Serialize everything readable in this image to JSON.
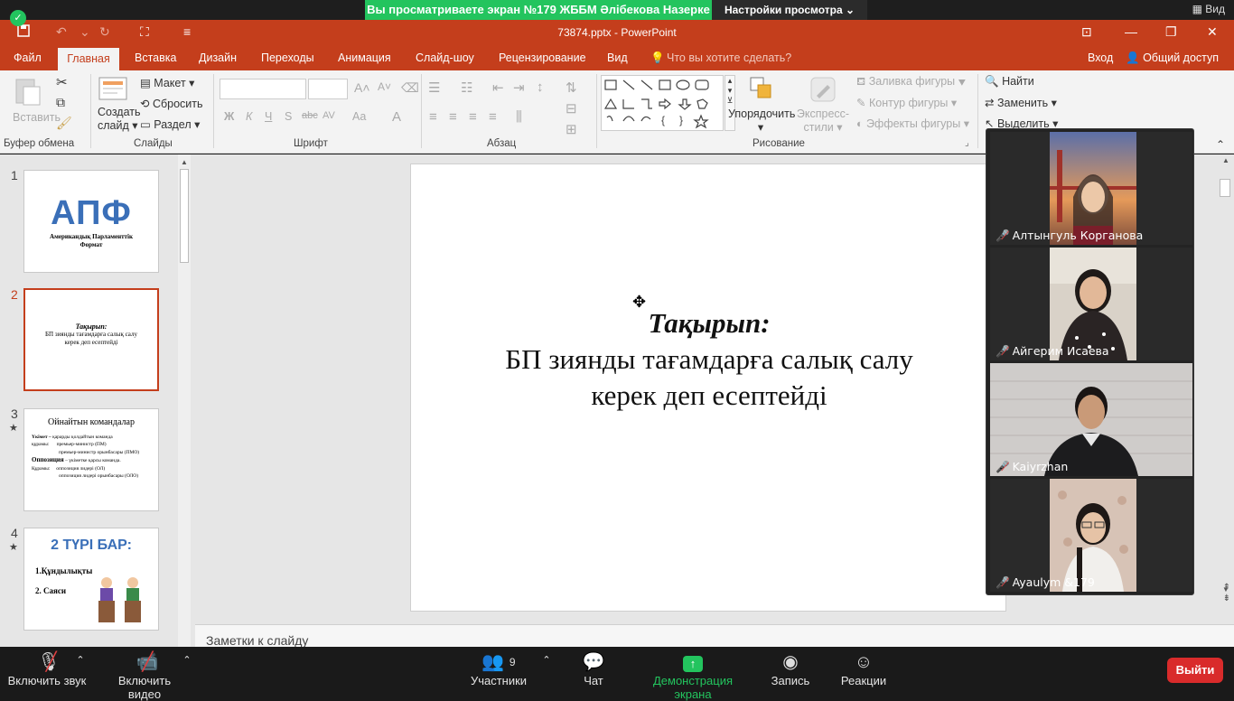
{
  "zoom_bar": {
    "share_text": "Вы просматриваете экран №179 ЖББМ Әлібекова Назерке",
    "view_settings": "Настройки просмотра",
    "view_label": "Вид"
  },
  "window": {
    "title": "73874.pptx - PowerPoint"
  },
  "tabs": [
    "Файл",
    "Главная",
    "Вставка",
    "Дизайн",
    "Переходы",
    "Анимация",
    "Слайд-шоу",
    "Рецензирование",
    "Вид"
  ],
  "tell_me": "Что вы хотите сделать?",
  "login": "Вход",
  "share": "Общий доступ",
  "ribbon": {
    "clipboard": {
      "paste": "Вставить",
      "group": "Буфер обмена"
    },
    "slides": {
      "new_slide_1": "Создать",
      "new_slide_2": "слайд",
      "layout": "Макет",
      "reset": "Сбросить",
      "section": "Раздел",
      "group": "Слайды"
    },
    "font": {
      "bold": "Ж",
      "italic": "К",
      "underline": "Ч",
      "shadow": "S",
      "strike": "abc",
      "spacing": "AV",
      "case": "Aa",
      "color": "A",
      "group": "Шрифт"
    },
    "paragraph": {
      "group": "Абзац"
    },
    "drawing": {
      "arrange": "Упорядочить",
      "styles_1": "Экспресс-",
      "styles_2": "стили",
      "fill": "Заливка фигуры",
      "outline": "Контур фигуры",
      "effects": "Эффекты фигуры",
      "group": "Рисование"
    },
    "editing": {
      "find": "Найти",
      "replace": "Заменить",
      "select": "Выделить"
    }
  },
  "slides": [
    {
      "num": "1",
      "title": "АПФ",
      "sub": "Американдық Парламенттік Формат"
    },
    {
      "num": "2",
      "title": "Тақырып:",
      "body": "БП зиянды тағамдарға салық салу керек деп есептейді"
    },
    {
      "num": "3",
      "title": "Ойнайтын командалар",
      "l1": "Үкімет –",
      "l1b": "қарарды қолдайтын команда",
      "l2": "құрамы:",
      "l2b": "премьер-министр (ПМ)",
      "l3": "премьер-министр орынбасары (ПМО)",
      "l4": "Оппозиция",
      "l4b": "– үкіметке қарсы команда.",
      "l5": "Құрамы:",
      "l5b": "оппозиция лидері (ОЛ)",
      "l6": "оппозиция лидері орынбасары (ОЛО)"
    },
    {
      "num": "4",
      "title": "2 ТҮРІ БАР:",
      "l1": "1.Құндылықты",
      "l2": "2. Саяси"
    }
  ],
  "main_slide": {
    "title": "Тақырып:",
    "line1": "БП зиянды тағамдарға салық салу",
    "line2": "керек деп есептейді"
  },
  "notes_placeholder": "Заметки к слайду",
  "participants": [
    {
      "name": "Алтынгуль Корганова"
    },
    {
      "name": "Айгерим Исаева"
    },
    {
      "name": "Kaiyrzhan"
    },
    {
      "name": "Ayaulym &179"
    }
  ],
  "controls": {
    "mute": "Включить звук",
    "video": "Включить видео",
    "participants": "Участники",
    "participants_count": "9",
    "chat": "Чат",
    "share": "Демонстрация экрана",
    "record": "Запись",
    "reactions": "Реакции",
    "leave": "Выйти"
  },
  "colors": {
    "accent": "#c43e1c",
    "zoom_green": "#23c45e",
    "leave_red": "#d92b2b"
  }
}
